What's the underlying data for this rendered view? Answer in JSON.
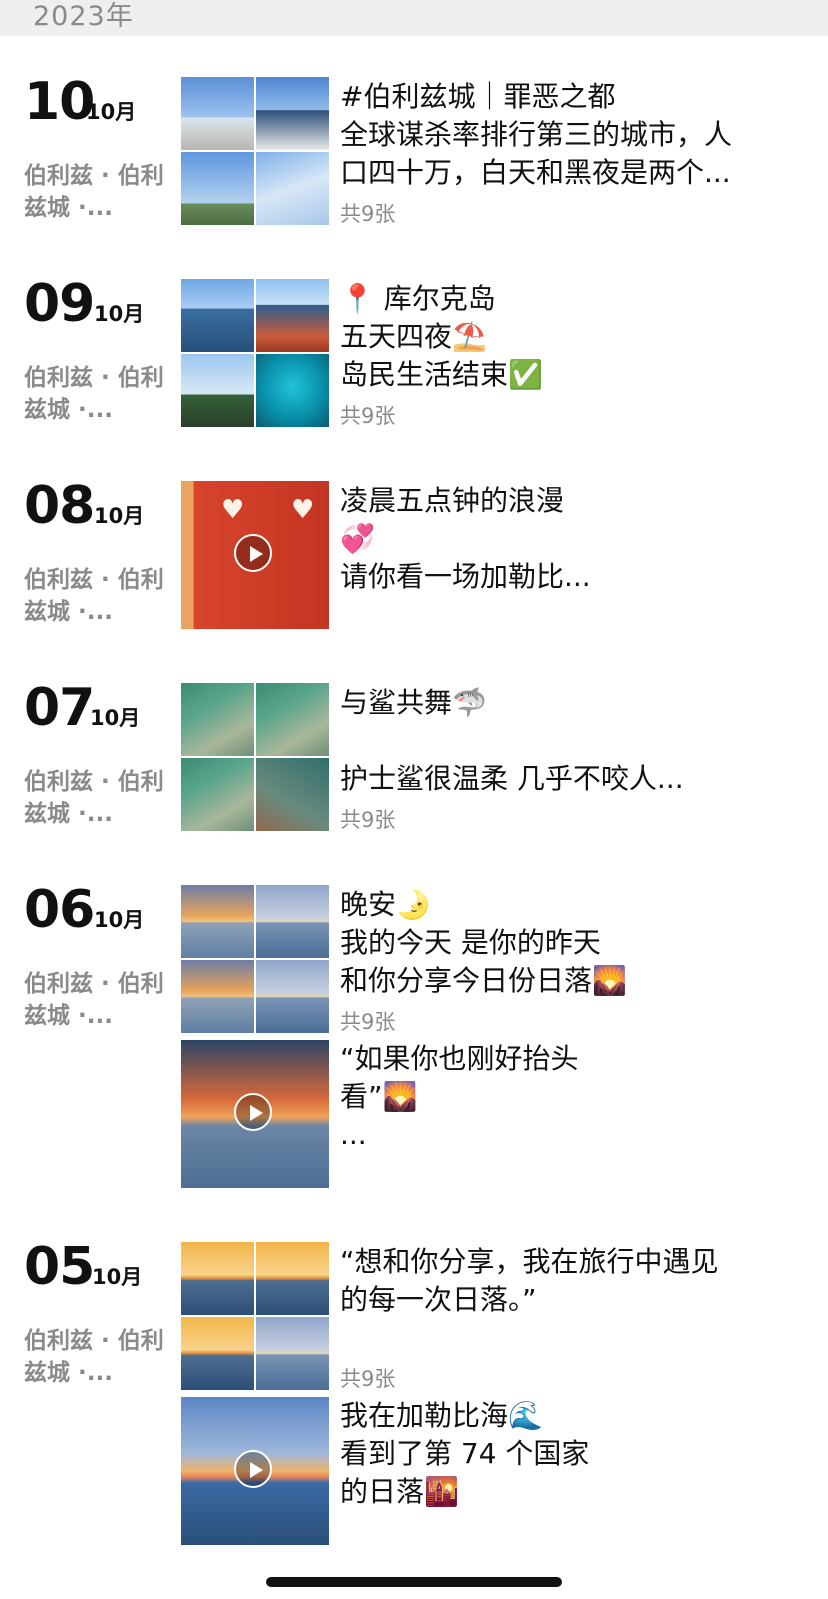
{
  "year": "2023年",
  "entries": [
    {
      "day": "10",
      "month": "10月",
      "location": "伯利兹 · 伯利兹城 ·...",
      "media": "grid",
      "thumbs": [
        "town",
        "belize-sign",
        "lighthouse",
        "clouds"
      ],
      "lines": [
        "#伯利兹城｜罪恶之都",
        "全球谋杀率排行第三的城市，人",
        "口四十万，白天和黑夜是两个..."
      ],
      "count": "共9张"
    },
    {
      "day": "09",
      "month": "10月",
      "location": "伯利兹 · 伯利兹城 ·...",
      "media": "grid",
      "thumbs": [
        "sea",
        "boat",
        "palm",
        "snorkel"
      ],
      "lines": [
        "📍 库尔克岛",
        "五天四夜⛱️",
        "岛民生活结束✅"
      ],
      "count": "共9张"
    },
    {
      "day": "08",
      "month": "10月",
      "location": "伯利兹 · 伯利兹城 ·...",
      "media": "video",
      "lines": [
        "凌晨五点钟的浪漫",
        "💞",
        "请你看一场加勒比..."
      ],
      "count": ""
    },
    {
      "day": "07",
      "month": "10月",
      "location": "伯利兹 · 伯利兹城 ·...",
      "media": "grid",
      "thumbs": [
        "shark",
        "shark",
        "shark",
        "shark"
      ],
      "lines": [
        "与鲨共舞🦈",
        "",
        "护士鲨很温柔 几乎不咬人..."
      ],
      "count": "共9张"
    },
    {
      "day": "06",
      "month": "10月",
      "location": "伯利兹 · 伯利兹城 ·...",
      "media": "grid",
      "thumbs": [
        "sunset",
        "sunset",
        "sunset",
        "sunset"
      ],
      "lines": [
        "晚安🌛",
        "我的今天 是你的昨天",
        "和你分享今日份日落🌄"
      ],
      "count": "共9张",
      "video_post": {
        "lines": [
          "“如果你也刚好抬头",
          "看”🌄",
          "..."
        ]
      }
    },
    {
      "day": "05",
      "month": "10月",
      "location": "伯利兹 · 伯利兹城 ·...",
      "media": "grid",
      "thumbs": [
        "sunset",
        "sunset",
        "sunset",
        "sunset"
      ],
      "lines": [
        "“想和你分享，我在旅行中遇见",
        "的每一次日落。”"
      ],
      "count": "共9张",
      "video_post": {
        "lines": [
          "我在加勒比海🌊",
          "看到了第 74 个国家",
          "的日落🌇"
        ]
      }
    }
  ],
  "colors": {
    "text": "#111111",
    "secondary": "#8a8a8a",
    "year_bar": "#efefef"
  }
}
